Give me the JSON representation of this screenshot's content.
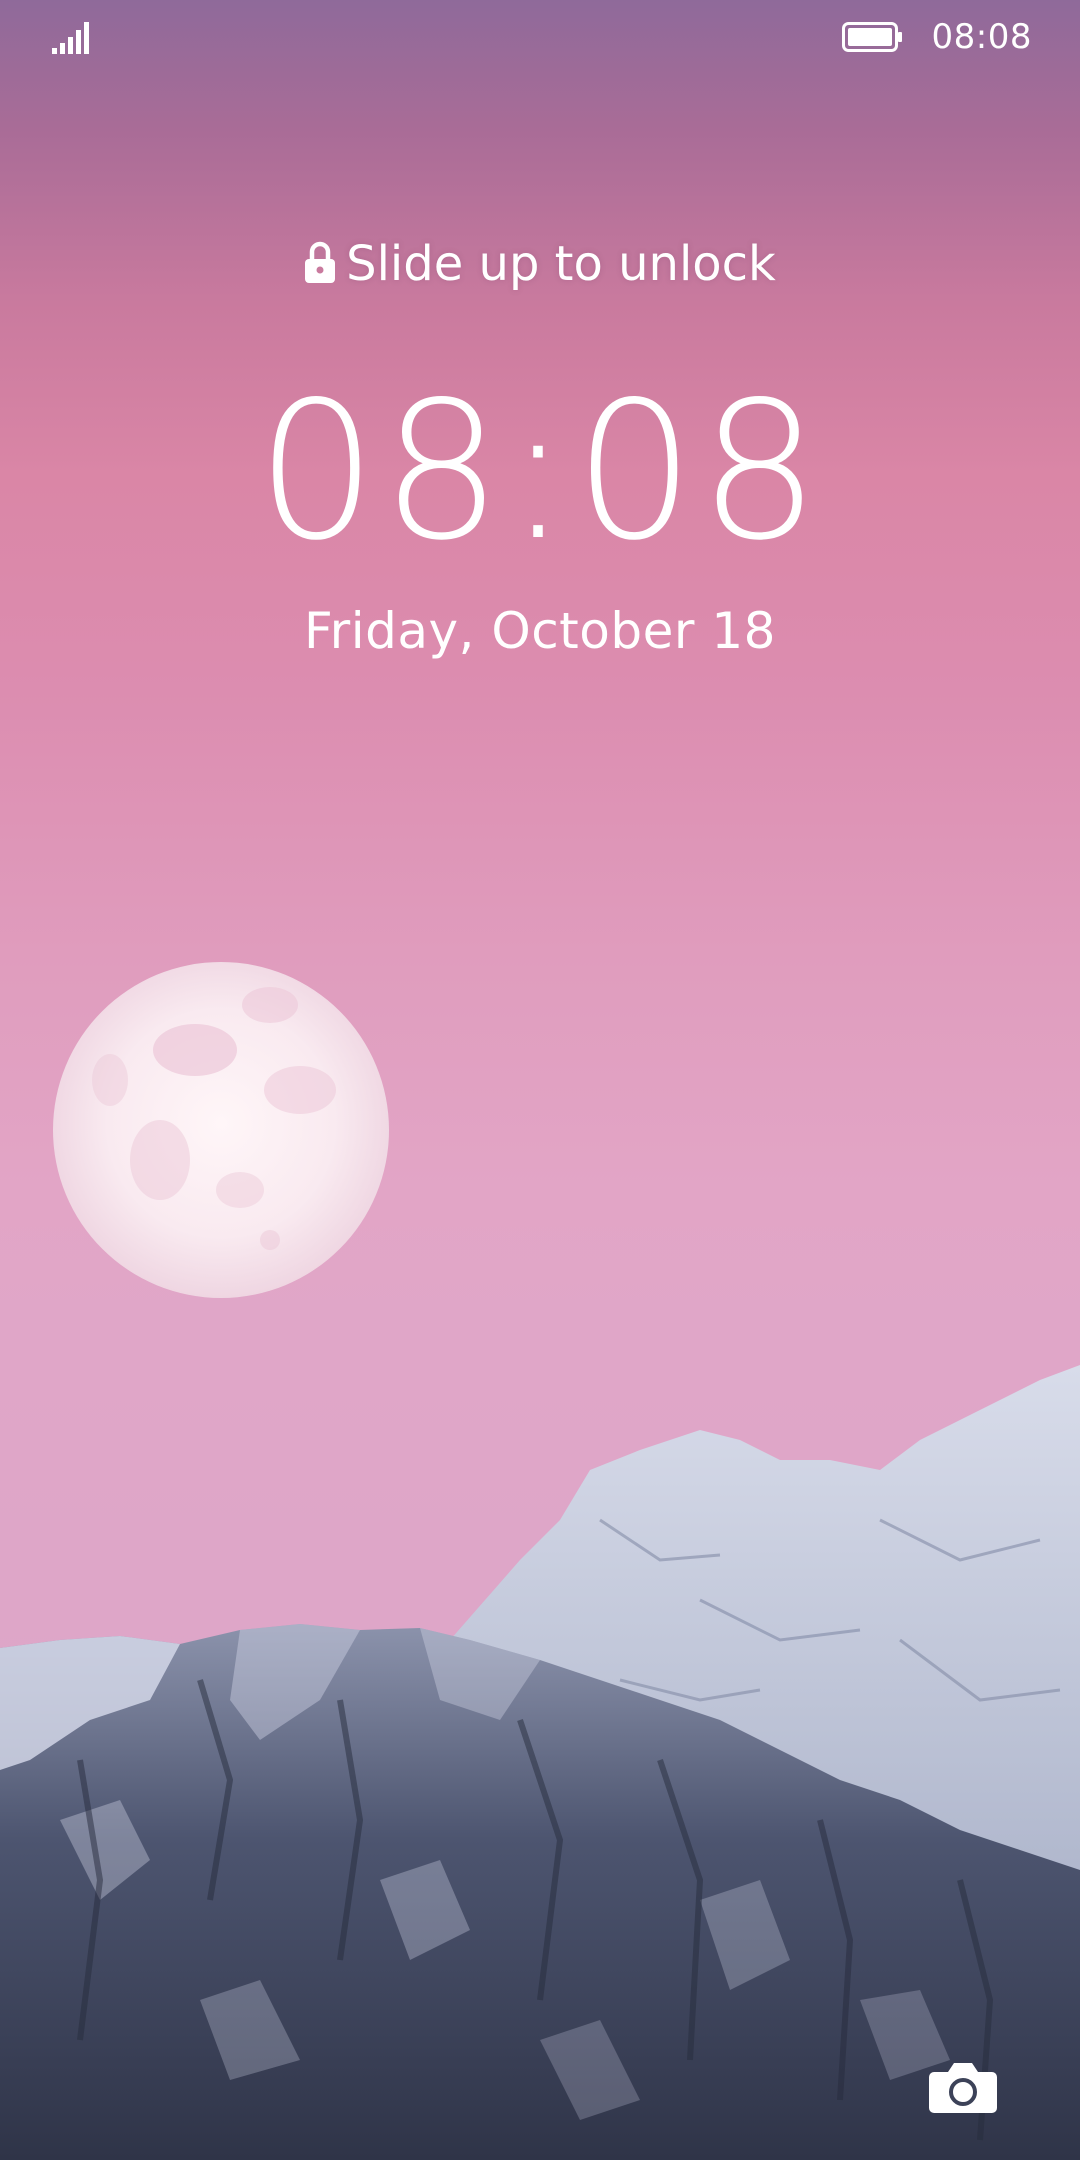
{
  "status_bar": {
    "time": "08:08",
    "signal_icon": "signal-bars-icon",
    "battery_icon": "battery-full-icon"
  },
  "lock_screen": {
    "unlock_hint": "Slide up to unlock",
    "lock_icon": "lock-icon",
    "clock": "08:08",
    "date": "Friday, October 18",
    "camera_icon": "camera-icon"
  },
  "colors": {
    "sky_top": "#8f6a9a",
    "sky_mid": "#da86a6",
    "sky_bottom": "#e0a6c8",
    "mountain_snow": "#c9cfe0",
    "mountain_rock": "#3c4258",
    "text": "#ffffff"
  }
}
